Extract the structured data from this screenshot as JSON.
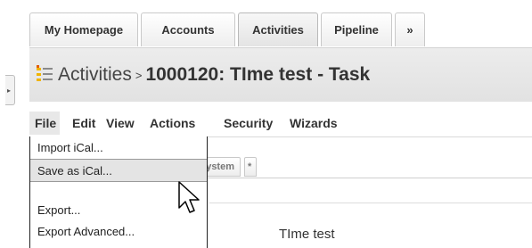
{
  "tabs": [
    {
      "label": "My Homepage",
      "active": false
    },
    {
      "label": "Accounts",
      "active": false
    },
    {
      "label": "Activities",
      "active": true
    },
    {
      "label": "Pipeline",
      "active": false
    },
    {
      "label": "»",
      "active": false
    }
  ],
  "header": {
    "module": "Activities",
    "separator": ">",
    "record": "1000120: TIme test - Task",
    "icon": "activities-list-icon"
  },
  "menubar": {
    "items": [
      "File",
      "Edit",
      "View",
      "Actions",
      "Security",
      "Wizards"
    ],
    "open": "File"
  },
  "file_menu": {
    "items": [
      "Import iCal...",
      "Save as iCal...",
      "Export...",
      "Export Advanced..."
    ],
    "hover": "Save as iCal..."
  },
  "subtabs": [
    "System",
    "*"
  ],
  "record_name": "TIme test",
  "cursor": "arrow-pointer-icon"
}
